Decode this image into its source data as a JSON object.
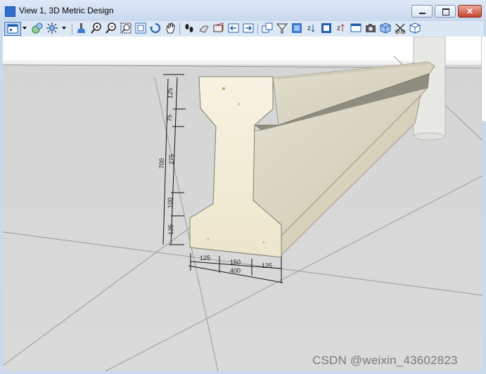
{
  "window": {
    "title": "View 1, 3D Metric Design",
    "controls": {
      "minimize": "minimize",
      "maximize": "maximize",
      "close": "close"
    }
  },
  "toolbar": {
    "tools": [
      {
        "name": "view-attributes-icon",
        "interactable": true
      },
      {
        "name": "dropdown-arrow-icon",
        "interactable": true
      },
      {
        "name": "display-style-icon",
        "interactable": true
      },
      {
        "name": "lighting-icon",
        "interactable": true
      },
      {
        "name": "dropdown-arrow-icon",
        "interactable": true
      },
      {
        "name": "update-view-icon",
        "interactable": true
      },
      {
        "name": "zoom-in-icon",
        "interactable": true
      },
      {
        "name": "zoom-out-icon",
        "interactable": true
      },
      {
        "name": "window-area-icon",
        "interactable": true
      },
      {
        "name": "fit-view-icon",
        "interactable": true
      },
      {
        "name": "rotate-view-icon",
        "interactable": true
      },
      {
        "name": "pan-view-icon",
        "interactable": true
      },
      {
        "name": "walk-icon",
        "interactable": true
      },
      {
        "name": "fly-icon",
        "interactable": true
      },
      {
        "name": "camera-icon",
        "interactable": true
      },
      {
        "name": "view-previous-icon",
        "interactable": true
      },
      {
        "name": "view-next-icon",
        "interactable": true
      },
      {
        "name": "copy-view-icon",
        "interactable": true
      },
      {
        "name": "clip-volume-icon",
        "interactable": true
      },
      {
        "name": "render-icon",
        "interactable": true
      },
      {
        "name": "z-front-icon",
        "interactable": true
      },
      {
        "name": "view-toggle-icon",
        "interactable": true
      },
      {
        "name": "z-back-icon",
        "interactable": true
      },
      {
        "name": "save-view-icon",
        "interactable": true
      },
      {
        "name": "snapshot-camera-icon",
        "interactable": true
      },
      {
        "name": "3d-cube-icon",
        "interactable": true
      },
      {
        "name": "clip-mask-icon",
        "interactable": true
      },
      {
        "name": "standard-views-icon",
        "interactable": true
      }
    ]
  },
  "drawing": {
    "vertical_dimensions": [
      "125",
      "75",
      "275",
      "100",
      "125"
    ],
    "total_height": "700",
    "bottom_dimensions": [
      "125",
      "150",
      "125"
    ],
    "total_width": "400"
  },
  "watermark": "CSDN @weixin_43602823"
}
